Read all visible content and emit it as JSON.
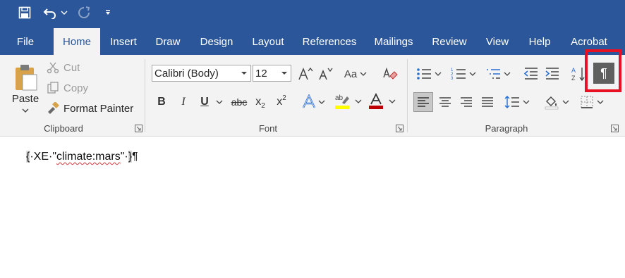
{
  "ribbon": {
    "tabs": [
      {
        "label": "File"
      },
      {
        "label": "Home"
      },
      {
        "label": "Insert"
      },
      {
        "label": "Draw"
      },
      {
        "label": "Design"
      },
      {
        "label": "Layout"
      },
      {
        "label": "References"
      },
      {
        "label": "Mailings"
      },
      {
        "label": "Review"
      },
      {
        "label": "View"
      },
      {
        "label": "Help"
      },
      {
        "label": "Acrobat"
      }
    ],
    "active_tab": "Home",
    "clipboard": {
      "paste_label": "Paste",
      "cut_label": "Cut",
      "copy_label": "Copy",
      "format_painter_label": "Format Painter",
      "group_label": "Clipboard"
    },
    "font": {
      "font_name": "Calibri (Body)",
      "font_size": "12",
      "bold": "B",
      "italic": "I",
      "underline": "U",
      "strike": "abc",
      "subscript_base": "x",
      "subscript_sub": "2",
      "superscript_base": "x",
      "superscript_sup": "2",
      "change_case": "Aa",
      "group_label": "Font",
      "font_color": "#c00000",
      "highlight_color": "#ffff00"
    },
    "paragraph": {
      "group_label": "Paragraph",
      "show_hide_mark": "¶"
    }
  },
  "document": {
    "brace_open": "{",
    "dot1": "·",
    "xe": "XE",
    "dot2": "·",
    "quote_open": "\"",
    "field_word": "climate:mars",
    "quote_close": "\"",
    "dot3": "·",
    "brace_close": "}",
    "pilcrow": "¶"
  },
  "colors": {
    "accent": "#2b579a",
    "ribbon_bg": "#f3f3f3",
    "callout": "#e81123"
  }
}
